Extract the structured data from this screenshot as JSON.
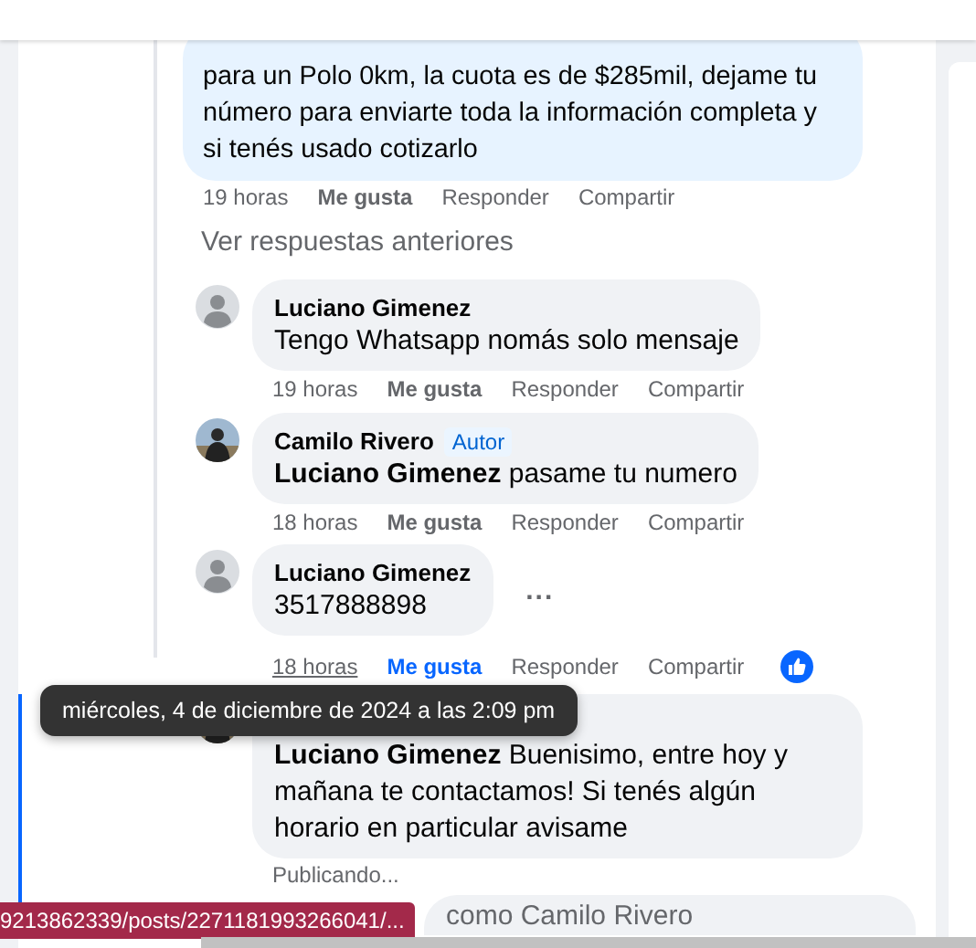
{
  "top_comment": {
    "text": "para un Polo 0km, la cuota es de $285mil, dejame tu número para enviarte toda la información completa y si tenés usado cotizarlo",
    "actions": {
      "time": "19 horas",
      "time_hovered": false,
      "like": "Me gusta",
      "liked": false,
      "reply": "Responder",
      "share": "Compartir"
    }
  },
  "previous_replies_link": "Ver respuestas anteriores",
  "replies": [
    {
      "avatar": {
        "kind": "default"
      },
      "author": "Luciano Gimenez",
      "text": "Tengo Whatsapp nomás solo mensaje",
      "actions": {
        "time": "19 horas",
        "time_hovered": false,
        "like": "Me gusta",
        "liked": false,
        "reply": "Responder",
        "share": "Compartir"
      }
    },
    {
      "avatar": {
        "kind": "photo"
      },
      "author": "Camilo Rivero",
      "badge": "Autor",
      "text": "**Luciano Gimenez** pasame tu numero",
      "actions": {
        "time": "18 horas",
        "time_hovered": false,
        "like": "Me gusta",
        "liked": false,
        "reply": "Responder",
        "share": "Compartir"
      }
    },
    {
      "avatar": {
        "kind": "default"
      },
      "author": "Luciano Gimenez",
      "text": "3517888898",
      "more": "...",
      "actions": {
        "time": "18 horas",
        "time_hovered": true,
        "like": "Me gusta",
        "liked": true,
        "reply": "Responder",
        "share": "Compartir"
      }
    },
    {
      "avatar": {
        "kind": "photo"
      },
      "text": "**Luciano Gimenez** Buenisimo, entre hoy y mañana te contactamos! Si tenés algún horario en particular avisame",
      "status": "Publicando..."
    }
  ],
  "composer": {
    "placeholder": "como Camilo Rivero"
  },
  "tooltip": {
    "text": "miércoles, 4 de diciembre de 2024 a las 2:09 pm"
  },
  "status_bar": {
    "url": "9213862339/posts/2271181993266041/..."
  }
}
